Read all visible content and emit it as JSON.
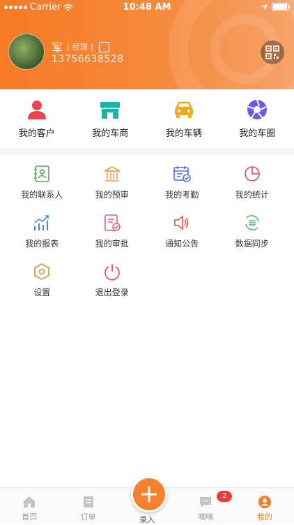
{
  "status_bar": {
    "carrier": "Carrier",
    "time": "10:48 AM"
  },
  "profile": {
    "name": "军",
    "role_tag": "[ 经理 ]",
    "phone": "13756638528"
  },
  "top_nav": [
    {
      "label": "我的客户",
      "icon": "customer-icon",
      "color": "#e8454f"
    },
    {
      "label": "我的车商",
      "icon": "store-icon",
      "color": "#1bb3a4"
    },
    {
      "label": "我的车辆",
      "icon": "car-icon",
      "color": "#f2a81e"
    },
    {
      "label": "我的车圈",
      "icon": "aperture-icon",
      "color": "#6b5ce7"
    }
  ],
  "grid": [
    {
      "label": "我的联系人",
      "icon": "contacts-icon",
      "color": "#4caf50"
    },
    {
      "label": "我的预审",
      "icon": "bank-icon",
      "color": "#e8a040"
    },
    {
      "label": "我的考勤",
      "icon": "calendar-check-icon",
      "color": "#4a6fd6"
    },
    {
      "label": "我的统计",
      "icon": "pie-chart-icon",
      "color": "#e8454f"
    },
    {
      "label": "我的报表",
      "icon": "report-chart-icon",
      "color": "#3d8ed8"
    },
    {
      "label": "我的审批",
      "icon": "approval-icon",
      "color": "#e8598a"
    },
    {
      "label": "通知公告",
      "icon": "speaker-icon",
      "color": "#e8553f"
    },
    {
      "label": "数据同步",
      "icon": "sync-icon",
      "color": "#3fbf6a"
    },
    {
      "label": "设置",
      "icon": "settings-hexagon-icon",
      "color": "#f08a2e"
    },
    {
      "label": "退出登录",
      "icon": "power-icon",
      "color": "#e8454f"
    }
  ],
  "tab_bar": {
    "home": "首页",
    "orders": "订单",
    "entry": "录入",
    "chat": "嘀嘀",
    "chat_badge": "2",
    "mine": "我的"
  },
  "colors": {
    "brand": "#f77a25",
    "badge": "#f03c3c"
  }
}
